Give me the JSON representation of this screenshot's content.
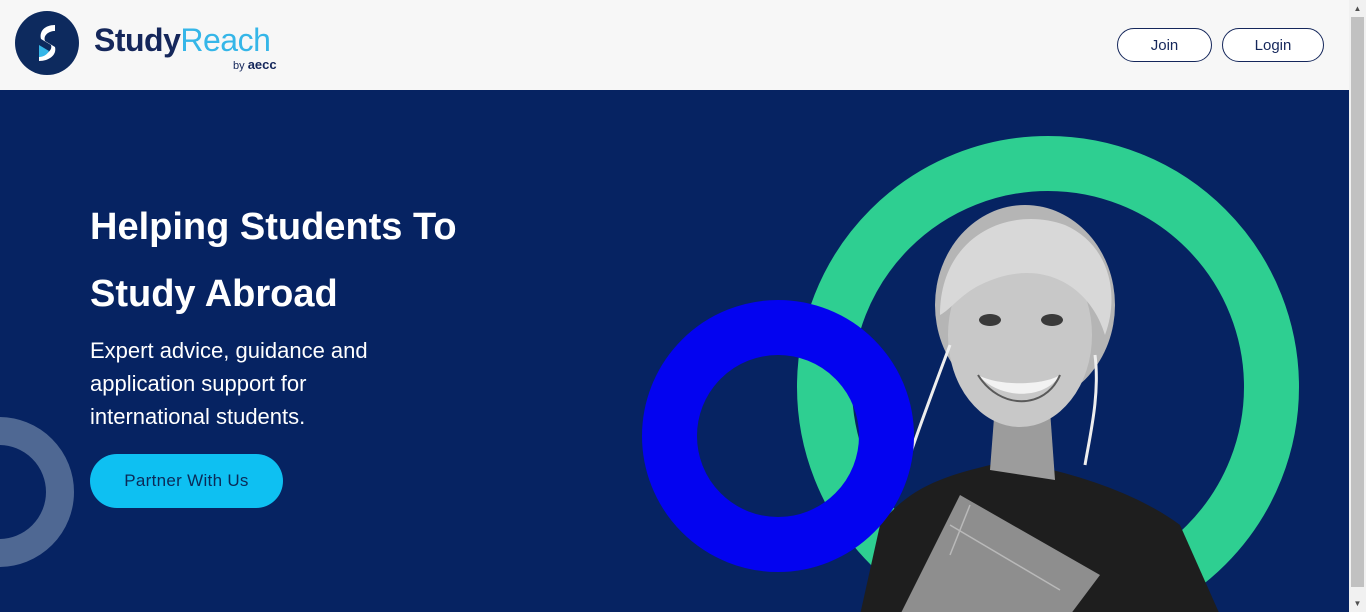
{
  "header": {
    "brand_study": "Study",
    "brand_reach": "Reach",
    "brand_by": "by",
    "brand_aecc": "aecc",
    "join_label": "Join",
    "login_label": "Login"
  },
  "hero": {
    "title": "Helping Students To Study Abroad",
    "subtitle": "Expert advice, guidance and application support for international students.",
    "cta_label": "Partner With Us"
  },
  "colors": {
    "header_bg": "#f7f7f7",
    "hero_bg": "#062362",
    "brand_dark": "#15275b",
    "brand_light": "#35b6e8",
    "cta_bg": "#0ec0f2",
    "ring_green": "#2ecf91",
    "ring_blue": "#0303f0"
  },
  "icons": {
    "logo": "studyreach-s-logo-icon",
    "scroll_up": "triangle-up-icon",
    "scroll_down": "triangle-down-icon"
  }
}
